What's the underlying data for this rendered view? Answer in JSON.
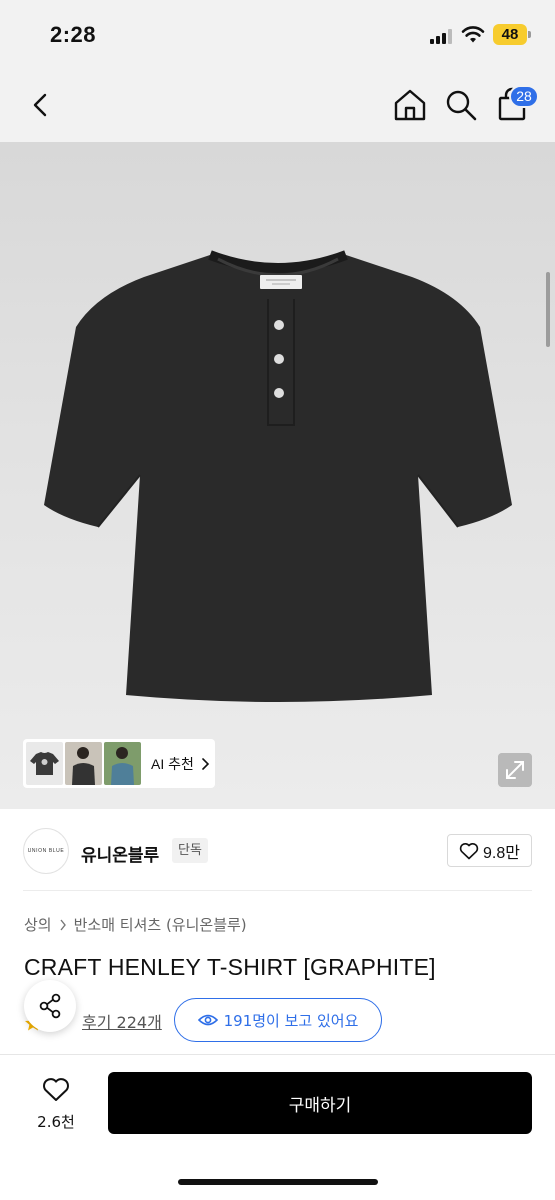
{
  "status_bar": {
    "time": "2:28",
    "battery": "48",
    "icons": [
      "signal-icon",
      "wifi-icon",
      "battery-icon"
    ]
  },
  "nav": {
    "icons": [
      "back-arrow-icon",
      "home-icon",
      "search-icon",
      "shopping-bag-icon"
    ],
    "cart_count": "28"
  },
  "product_image": {
    "ai_recommend_label": "AI 추천",
    "thumbnails": [
      "tshirt-thumbnail",
      "model-thumbnail-1",
      "model-thumbnail-2"
    ]
  },
  "brand": {
    "logo_text": "UNION BLUE",
    "name": "유니온블루",
    "badge": "단독",
    "likes": "9.8만"
  },
  "product": {
    "breadcrumb": [
      "상의",
      "반소매 티셔츠 (유니온블루)"
    ],
    "title": "CRAFT HENLEY T-SHIRT [GRAPHITE]",
    "reviews": "후기 224개",
    "viewers": "191명이 보고 있어요"
  },
  "bottom_bar": {
    "wish_count": "2.6천",
    "buy_label": "구매하기"
  },
  "colors": {
    "accent_blue": "#2f6fe8",
    "buy_button": "#000000",
    "shirt": "#2a2a2a",
    "battery": "#f7cc2e"
  }
}
